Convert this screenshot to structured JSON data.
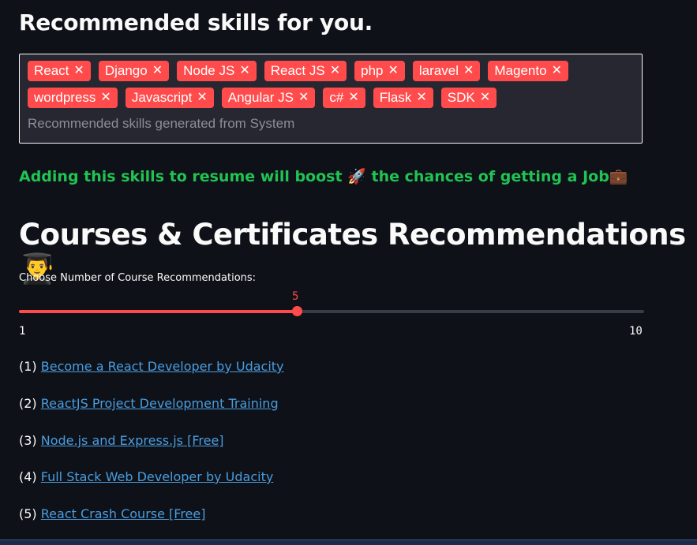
{
  "skills_heading": "Recommended skills for you.",
  "skills_input": {
    "tags": [
      "React",
      "Django",
      "Node JS",
      "React JS",
      "php",
      "laravel",
      "Magento",
      "wordpress",
      "Javascript",
      "Angular JS",
      "c#",
      "Flask",
      "SDK"
    ],
    "placeholder": "Recommended skills generated from System"
  },
  "boost_text": "Adding this skills to resume will boost",
  "boost_emoji_1": "🚀",
  "boost_text_2": "the chances of getting a Job",
  "boost_emoji_2": "💼",
  "courses_heading": "Courses & Certificates Recommendations",
  "courses_heading_emoji": "👨‍🎓",
  "slider": {
    "label": "Choose Number of Course Recommendations:",
    "value": "5",
    "min": "1",
    "max": "10",
    "accent_color": "#ff4b4b"
  },
  "courses": [
    {
      "index": "(1)",
      "title": "Become a React Developer by Udacity"
    },
    {
      "index": "(2)",
      "title": "ReactJS Project Development Training"
    },
    {
      "index": "(3)",
      "title": "Node.js and Express.js [Free]"
    },
    {
      "index": "(4)",
      "title": "Full Stack Web Developer by Udacity"
    },
    {
      "index": "(5)",
      "title": "React Crash Course [Free]"
    }
  ]
}
